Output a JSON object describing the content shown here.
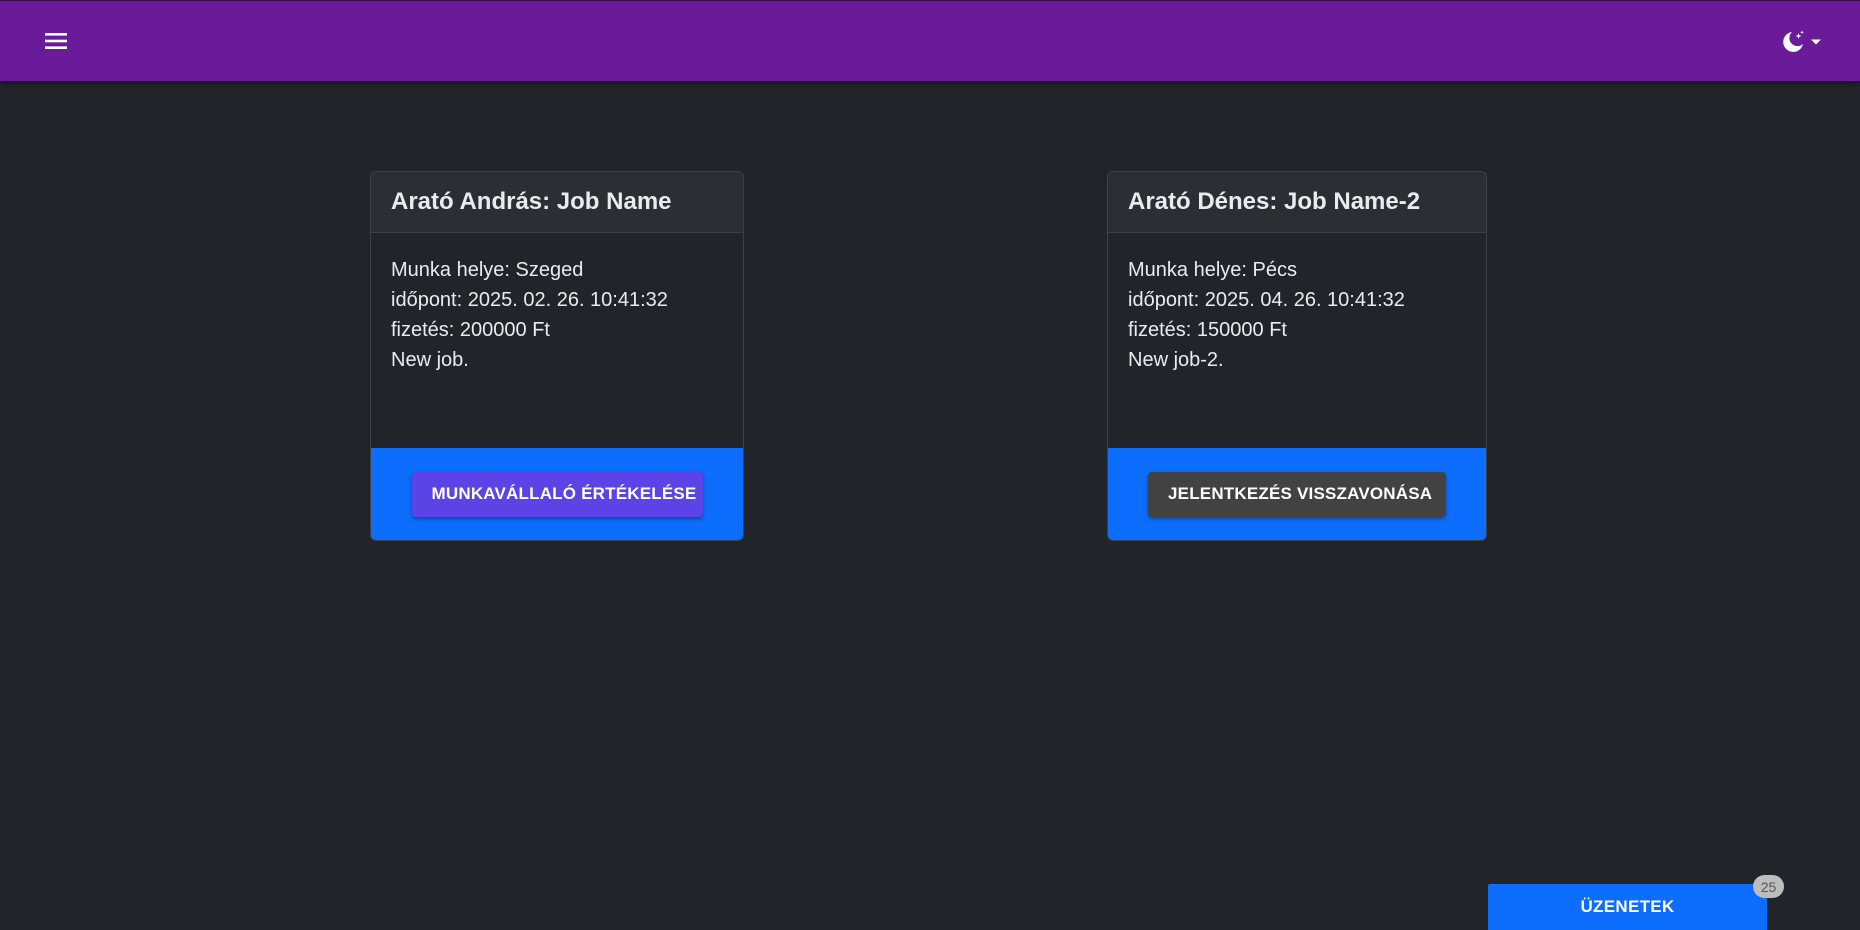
{
  "header": {
    "menu_icon": "hamburger-menu-icon",
    "theme_icon": "moon-stars-icon",
    "theme_dropdown_icon": "caret-down-icon",
    "background_color": "#6a1b9a"
  },
  "jobs": [
    {
      "title": "Arató András: Job Name",
      "location": "Munka helye: Szeged",
      "time": "időpont: 2025. 02. 26. 10:41:32",
      "salary": "fizetés: 200000 Ft",
      "description": "New job.",
      "action_label": "MUNKAVÁLLALÓ ÉRTÉKELÉSE",
      "action_color": "#5b43e6"
    },
    {
      "title": "Arató Dénes: Job Name-2",
      "location": "Munka helye: Pécs",
      "time": "időpont: 2025. 04. 26. 10:41:32",
      "salary": "fizetés: 150000 Ft",
      "description": "New job-2.",
      "action_label": "JELENTKEZÉS VISSZAVONÁSA",
      "action_color": "#424242"
    }
  ],
  "messages": {
    "label": "ÜZENETEK",
    "count": "25"
  },
  "colors": {
    "page_background": "#212529",
    "card_footer": "#0d6efd"
  }
}
